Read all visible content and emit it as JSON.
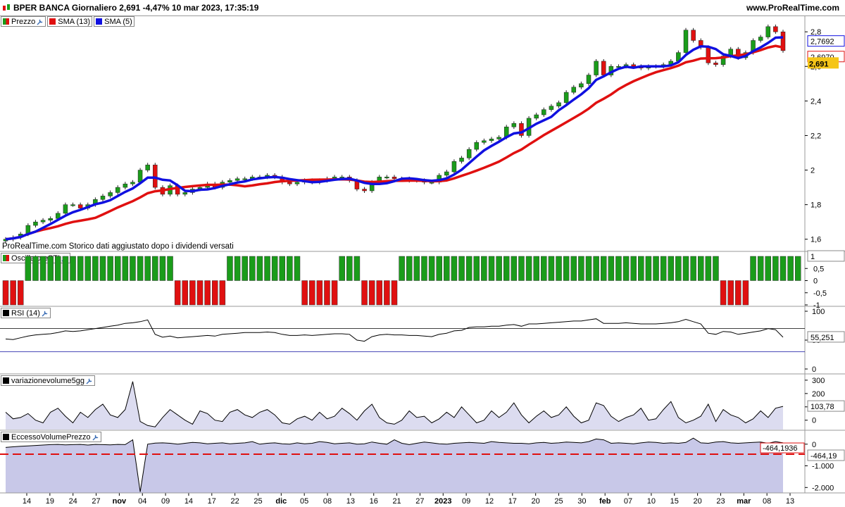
{
  "header": {
    "title": "BPER BANCA Giornaliero 2,691 -4,47% 10 mar 2023, 17:35:19",
    "site": "www.ProRealTime.com"
  },
  "footnote": "ProRealTime.com  Storico dati aggiustato dopo i dividendi versati",
  "panels": {
    "price": {
      "legend": [
        {
          "label": "Prezzo",
          "color": "#1a9c1a"
        },
        {
          "label": "SMA (13)",
          "color": "#e01010"
        },
        {
          "label": "SMA (5)",
          "color": "#1010e0"
        }
      ]
    },
    "osc": {
      "legend": "OscillatoreSTI"
    },
    "rsi": {
      "legend": "RSI (14)"
    },
    "vol": {
      "legend": "variazionevolume5gg"
    },
    "ecc": {
      "legend": "EccessoVolumePrezzo"
    }
  },
  "colors": {
    "up": "#1a9c1a",
    "down": "#e01010",
    "sma13": "#e01010",
    "sma5": "#1010e0",
    "label_price_bg": "#f5c518"
  },
  "chart_data": [
    {
      "type": "candlestick",
      "title": "Prezzo",
      "ylim": [
        1.55,
        2.87
      ],
      "yticks": [
        "1,6",
        "1,8",
        "2",
        "2,2",
        "2,4",
        "2,6",
        "2,8"
      ],
      "ytick_values": [
        1.6,
        1.8,
        2.0,
        2.2,
        2.4,
        2.6,
        2.8
      ],
      "x_labels": [
        "14",
        "19",
        "24",
        "27",
        "nov",
        "04",
        "09",
        "14",
        "17",
        "22",
        "25",
        "dic",
        "05",
        "08",
        "13",
        "16",
        "21",
        "27",
        "2023",
        "09",
        "12",
        "17",
        "20",
        "25",
        "30",
        "feb",
        "07",
        "10",
        "15",
        "20",
        "23",
        "mar",
        "08",
        "13"
      ],
      "close": [
        1.6,
        1.61,
        1.63,
        1.68,
        1.7,
        1.71,
        1.72,
        1.75,
        1.8,
        1.8,
        1.78,
        1.8,
        1.83,
        1.85,
        1.87,
        1.9,
        1.92,
        1.93,
        2.0,
        2.03,
        1.9,
        1.86,
        1.91,
        1.86,
        1.87,
        1.89,
        1.9,
        1.92,
        1.9,
        1.93,
        1.94,
        1.95,
        1.95,
        1.96,
        1.96,
        1.97,
        1.96,
        1.93,
        1.92,
        1.93,
        1.94,
        1.93,
        1.94,
        1.95,
        1.96,
        1.96,
        1.94,
        1.89,
        1.88,
        1.93,
        1.96,
        1.96,
        1.95,
        1.95,
        1.94,
        1.94,
        1.93,
        1.93,
        1.97,
        1.99,
        2.05,
        2.07,
        2.12,
        2.16,
        2.17,
        2.18,
        2.19,
        2.25,
        2.27,
        2.2,
        2.3,
        2.32,
        2.35,
        2.37,
        2.39,
        2.45,
        2.48,
        2.5,
        2.55,
        2.63,
        2.55,
        2.6,
        2.6,
        2.61,
        2.6,
        2.59,
        2.6,
        2.6,
        2.61,
        2.63,
        2.68,
        2.81,
        2.75,
        2.71,
        2.62,
        2.61,
        2.66,
        2.7,
        2.65,
        2.68,
        2.75,
        2.77,
        2.83,
        2.8,
        2.691
      ],
      "series": [
        {
          "name": "SMA (13)",
          "last_value": "2,6970"
        },
        {
          "name": "SMA (5)",
          "last_value": "2,7692"
        }
      ],
      "last_price": "2,691"
    },
    {
      "type": "bar",
      "title": "OscillatoreSTI",
      "yticks": [
        "0,5",
        "0",
        "-0,5",
        "-1"
      ],
      "ytick_values": [
        0.5,
        0,
        -0.5,
        -1
      ],
      "last_value": "1",
      "values": [
        -1,
        -1,
        -1,
        1,
        1,
        1,
        1,
        1,
        1,
        1,
        1,
        1,
        1,
        1,
        1,
        1,
        1,
        1,
        1,
        1,
        1,
        1,
        1,
        -1,
        -1,
        -1,
        -1,
        -1,
        -1,
        -1,
        1,
        1,
        1,
        1,
        1,
        1,
        1,
        1,
        1,
        1,
        -1,
        -1,
        -1,
        -1,
        -1,
        1,
        1,
        1,
        -1,
        -1,
        -1,
        -1,
        -1,
        1,
        1,
        1,
        1,
        1,
        1,
        1,
        1,
        1,
        1,
        1,
        1,
        1,
        1,
        1,
        1,
        1,
        1,
        1,
        1,
        1,
        1,
        1,
        1,
        1,
        1,
        1,
        1,
        1,
        1,
        1,
        1,
        1,
        1,
        1,
        1,
        1,
        1,
        1,
        1,
        1,
        1,
        1,
        -1,
        -1,
        -1,
        -1,
        1,
        1,
        1,
        1,
        1,
        1,
        1
      ]
    },
    {
      "type": "line",
      "title": "RSI (14)",
      "ylim": [
        0,
        100
      ],
      "yticks": [
        "100",
        "50",
        "0"
      ],
      "ytick_values": [
        100,
        50,
        0
      ],
      "levels": [
        70,
        30
      ],
      "last_value": "55,251",
      "values": [
        52,
        51,
        54,
        57,
        59,
        60,
        61,
        63,
        66,
        65,
        66,
        68,
        70,
        72,
        74,
        76,
        79,
        80,
        82,
        85,
        60,
        55,
        57,
        54,
        55,
        56,
        57,
        58,
        57,
        60,
        61,
        62,
        63,
        63,
        63,
        64,
        63,
        60,
        58,
        58,
        59,
        58,
        59,
        60,
        61,
        61,
        60,
        50,
        48,
        56,
        59,
        60,
        59,
        59,
        58,
        58,
        57,
        56,
        60,
        62,
        66,
        67,
        72,
        73,
        73,
        74,
        74,
        76,
        77,
        74,
        78,
        78,
        79,
        80,
        81,
        82,
        83,
        83,
        85,
        87,
        79,
        79,
        79,
        80,
        79,
        78,
        78,
        78,
        79,
        80,
        82,
        86,
        82,
        78,
        62,
        60,
        65,
        64,
        60,
        62,
        64,
        66,
        70,
        68,
        55
      ]
    },
    {
      "type": "area",
      "title": "variazionevolume5gg",
      "ylim": [
        -70,
        310
      ],
      "yticks": [
        "300",
        "200",
        "100",
        "0"
      ],
      "ytick_values": [
        300,
        200,
        100,
        0
      ],
      "last_value": "103,78",
      "values": [
        60,
        10,
        20,
        50,
        0,
        -20,
        60,
        90,
        30,
        -20,
        60,
        20,
        80,
        120,
        40,
        20,
        80,
        290,
        -10,
        -40,
        -50,
        20,
        80,
        40,
        0,
        -30,
        70,
        50,
        0,
        -10,
        60,
        80,
        40,
        20,
        60,
        80,
        40,
        -20,
        -30,
        10,
        30,
        0,
        60,
        10,
        30,
        90,
        50,
        0,
        70,
        120,
        20,
        -20,
        -30,
        0,
        70,
        20,
        30,
        -20,
        10,
        60,
        20,
        100,
        40,
        -20,
        0,
        70,
        20,
        60,
        130,
        40,
        -20,
        30,
        70,
        20,
        40,
        100,
        30,
        -20,
        0,
        130,
        110,
        30,
        -10,
        20,
        40,
        90,
        0,
        10,
        80,
        140,
        20,
        -20,
        0,
        30,
        120,
        -10,
        80,
        40,
        20,
        -20,
        10,
        70,
        20,
        90,
        103.78
      ]
    },
    {
      "type": "area",
      "title": "EccessoVolumePrezzo",
      "ylim": [
        -2250,
        350
      ],
      "yticks": [
        "0",
        "-1.000",
        "-2.000"
      ],
      "ytick_values": [
        0,
        -1000,
        -2000
      ],
      "levels": [
        -464.1936
      ],
      "last_value": "-464,19",
      "level_label": "-464,1936",
      "values": [
        -150,
        -120,
        -100,
        -80,
        -60,
        -40,
        -20,
        -10,
        -30,
        -20,
        -10,
        -40,
        -10,
        -20,
        -30,
        -10,
        -20,
        200,
        -2200,
        0,
        50,
        60,
        40,
        0,
        40,
        80,
        60,
        20,
        40,
        60,
        20,
        40,
        60,
        120,
        0,
        40,
        60,
        20,
        0,
        60,
        20,
        40,
        120,
        80,
        20,
        40,
        60,
        0,
        20,
        100,
        40,
        0,
        200,
        40,
        -20,
        40,
        100,
        60,
        20,
        0,
        40,
        60,
        80,
        60,
        40,
        120,
        80,
        60,
        40,
        40,
        20,
        60,
        80,
        40,
        60,
        100,
        80,
        60,
        120,
        240,
        200,
        40,
        60,
        40,
        20,
        60,
        100,
        80,
        40,
        60,
        40,
        80,
        280,
        60,
        40,
        100,
        120,
        60,
        40,
        60,
        80,
        100,
        40,
        120,
        60
      ]
    }
  ]
}
